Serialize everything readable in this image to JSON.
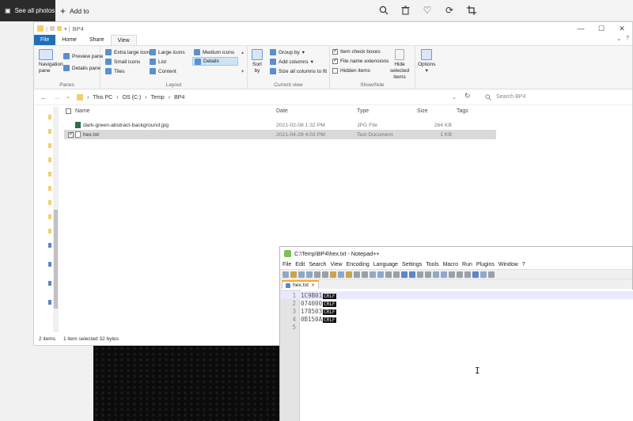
{
  "photos_bar": {
    "see_all": "See all photos",
    "add_to": "Add to",
    "tools": [
      "zoom-icon",
      "delete-icon",
      "favorite-icon",
      "rotate-icon",
      "crop-icon"
    ]
  },
  "explorer": {
    "title": "BP4",
    "tabs": [
      "File",
      "Home",
      "Share",
      "View"
    ],
    "ribbon": {
      "panes": {
        "label": "Panes",
        "navigation_pane": "Navigation pane",
        "preview_pane": "Preview pane",
        "details_pane": "Details pane"
      },
      "layout": {
        "label": "Layout",
        "items": [
          "Extra large icons",
          "Large icons",
          "Medium icons",
          "Small icons",
          "List",
          "Details",
          "Tiles",
          "Content"
        ]
      },
      "current_view": {
        "label": "Current view",
        "sort_by": "Sort by",
        "group_by": "Group by",
        "add_columns": "Add columns",
        "size_all_columns": "Size all columns to fit"
      },
      "show_hide": {
        "label": "Show/hide",
        "item_check_boxes": "Item check boxes",
        "file_name_extensions": "File name extensions",
        "hidden_items": "Hidden items",
        "hide_selected": "Hide selected items"
      },
      "options": "Options"
    },
    "breadcrumb": [
      "This PC",
      "OS (C:)",
      "Temp",
      "BP4"
    ],
    "search_placeholder": "Search BP4",
    "columns": {
      "name": "Name",
      "date": "Date",
      "type": "Type",
      "size": "Size",
      "tags": "Tags"
    },
    "files": [
      {
        "name": "dark-green-abstract-background.jpg",
        "date": "2021-02-08 1:32 PM",
        "type": "JPG File",
        "size": "264 KB"
      },
      {
        "name": "hex.txt",
        "date": "2021-04-29 4:02 PM",
        "type": "Text Document",
        "size": "1 KB"
      }
    ],
    "status": {
      "count": "2 items",
      "selected": "1 item selected  32 bytes"
    }
  },
  "notepad": {
    "title": "C:\\Temp\\BP4\\hex.txt - Notepad++",
    "menu": [
      "File",
      "Edit",
      "Search",
      "View",
      "Encoding",
      "Language",
      "Settings",
      "Tools",
      "Macro",
      "Run",
      "Plugins",
      "Window",
      "?"
    ],
    "tab": "hex.txt",
    "lines": [
      {
        "num": "1",
        "text": "1C9B01",
        "eol": "CRLF"
      },
      {
        "num": "2",
        "text": "074000",
        "eol": "CRLF"
      },
      {
        "num": "3",
        "text": "178503",
        "eol": "CRLF"
      },
      {
        "num": "4",
        "text": "0B150A",
        "eol": "CRLF"
      },
      {
        "num": "5",
        "text": "",
        "eol": ""
      }
    ]
  }
}
